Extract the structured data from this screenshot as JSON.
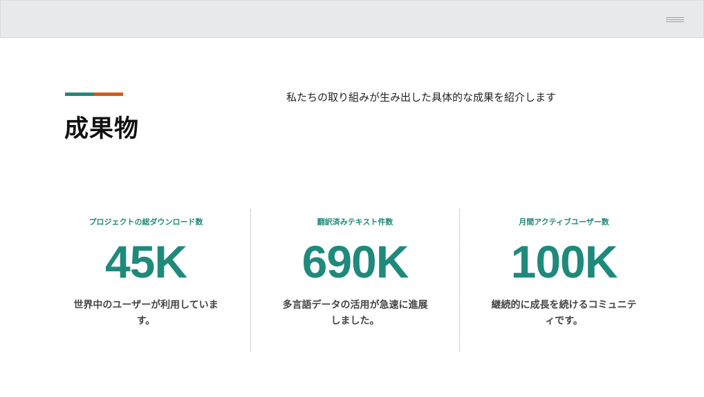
{
  "header": {
    "menu_icon": "hamburger-menu-icon"
  },
  "colors": {
    "accent_teal": "#1f8a7b",
    "accent_orange": "#d95a16",
    "top_bar": "#e7eaea"
  },
  "page": {
    "title": "成果物",
    "subtitle": "私たちの取り組みが生み出した具体的な成果を紹介します"
  },
  "stats": [
    {
      "label": "プロジェクトの総ダウンロード数",
      "value": "45K",
      "description": "世界中のユーザーが利用しています。"
    },
    {
      "label": "翻訳済みテキスト件数",
      "value": "690K",
      "description": "多言語データの活用が急速に進展しました。"
    },
    {
      "label": "月間アクティブユーザー数",
      "value": "100K",
      "description": "継続的に成長を続けるコミュニティです。"
    }
  ]
}
